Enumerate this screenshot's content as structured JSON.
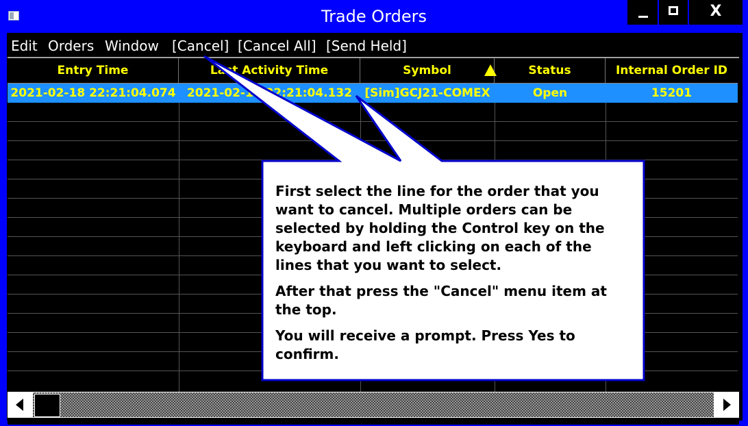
{
  "window": {
    "title": "Trade Orders",
    "close_glyph": "X"
  },
  "menu": {
    "edit": "Edit",
    "orders": "Orders",
    "window": "Window",
    "cancel": "[Cancel]",
    "cancel_all": "[Cancel All]",
    "send_held": "[Send Held]"
  },
  "table": {
    "columns": [
      "Entry Time",
      "Last Activity Time",
      "Symbol",
      "Status",
      "Internal Order ID"
    ],
    "sort_column": "Symbol",
    "sort_direction": "ascending",
    "rows": [
      {
        "entry_time": "2021-02-18  22:21:04.074",
        "last_activity_time": "2021-02-18  22:21:04.132",
        "symbol": "[Sim]GCJ21-COMEX",
        "status": "Open",
        "internal_order_id": "15201",
        "selected": true
      }
    ]
  },
  "callout": {
    "paragraphs": [
      "First select the line for the order that you want to cancel. Multiple orders can be selected by holding the Control key on the keyboard and left clicking on each of the lines that you want to select.",
      "After that press the \"Cancel\" menu item at the top.",
      "You will receive a prompt. Press Yes to confirm."
    ]
  },
  "colors": {
    "frame": "#0000ff",
    "background": "#000000",
    "header_text": "#ffff00",
    "selected_row": "#1e90ff",
    "callout_border": "#0000cc"
  }
}
